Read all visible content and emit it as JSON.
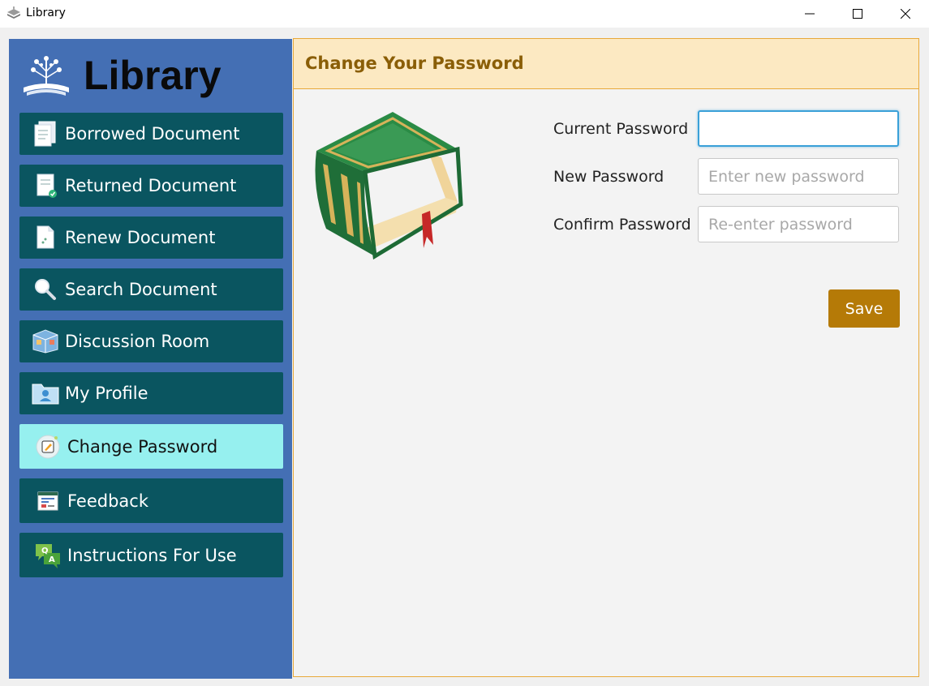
{
  "window": {
    "title": "Library"
  },
  "sidebar": {
    "brand": "Library",
    "items": [
      {
        "label": "Borrowed Document",
        "icon": "document-stack-icon"
      },
      {
        "label": "Returned Document",
        "icon": "document-check-icon"
      },
      {
        "label": "Renew Document",
        "icon": "document-renew-icon"
      },
      {
        "label": "Search Document",
        "icon": "magnifier-icon"
      },
      {
        "label": "Discussion Room",
        "icon": "room-icon"
      },
      {
        "label": "My Profile",
        "icon": "profile-folder-icon"
      },
      {
        "label": "Change Password",
        "icon": "pencil-badge-icon",
        "active": true
      },
      {
        "label": "Feedback",
        "icon": "feedback-form-icon"
      },
      {
        "label": "Instructions For Use",
        "icon": "qa-bubbles-icon"
      }
    ]
  },
  "main": {
    "heading": "Change Your Password",
    "form": {
      "current_label": "Current Password",
      "current_value": "",
      "new_label": "New Password",
      "new_placeholder": "Enter new password",
      "confirm_label": "Confirm Password",
      "confirm_placeholder": "Re-enter password",
      "save_label": "Save"
    }
  },
  "colors": {
    "sidebar_bg": "#446fb4",
    "nav_item": "#0a5560",
    "nav_active": "#96f0ef",
    "header_bg": "#fce9c2",
    "heading_text": "#8a5e07",
    "save_button": "#b57a07"
  }
}
